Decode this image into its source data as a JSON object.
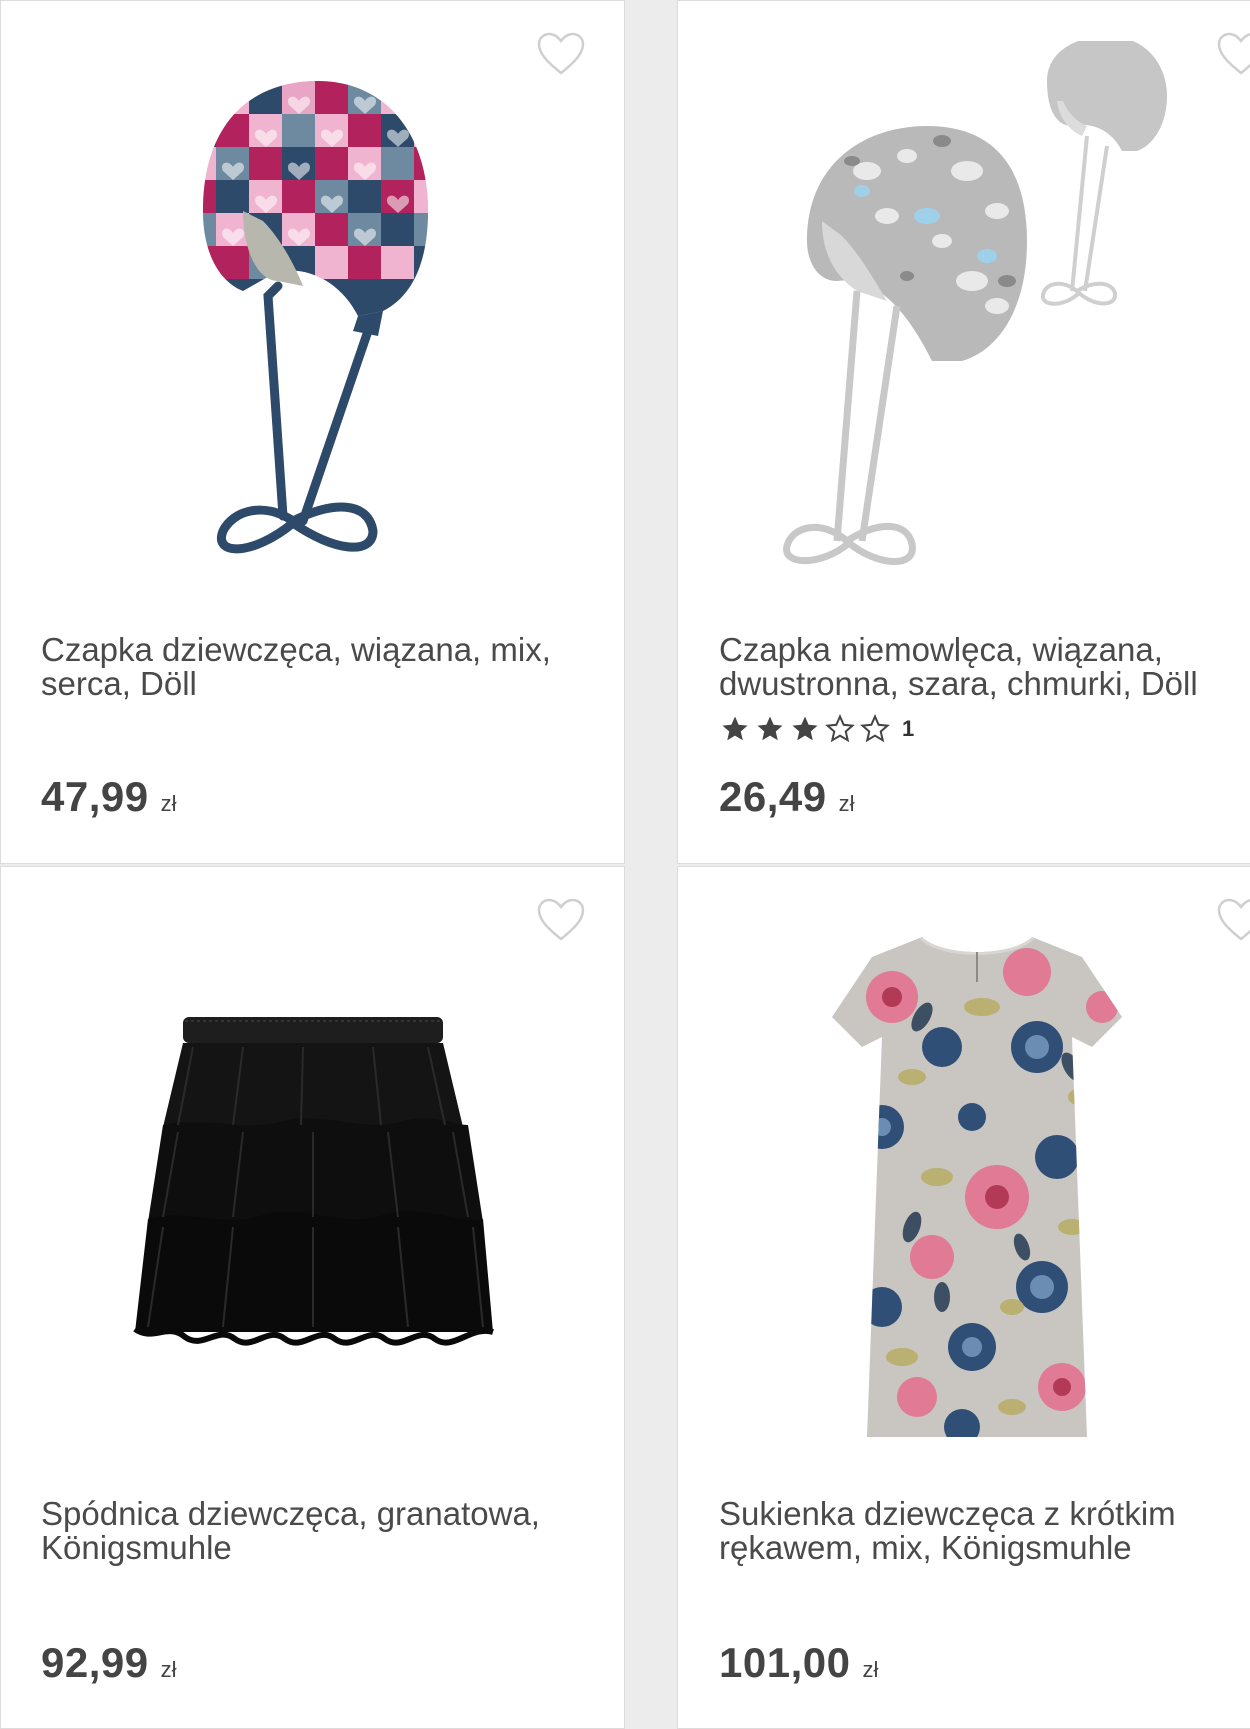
{
  "products": [
    {
      "title": "Czapka dziewczęca, wiązana, mix, serca, Döll",
      "price": "47,99",
      "currency": "zł",
      "image": "knitted-heart-hat-image"
    },
    {
      "title": "Czapka niemowlęca, wiązana, dwustronna, szara, chmurki, Döll",
      "price": "26,49",
      "currency": "zł",
      "rating": 3,
      "rating_max": 5,
      "rating_count": "1",
      "image": "grey-cloud-hat-image"
    },
    {
      "title": "Spódnica dziewczęca, granatowa, Königsmuhle",
      "price": "92,99",
      "currency": "zł",
      "image": "black-tulle-skirt-image"
    },
    {
      "title": "Sukienka dziewczęca z krótkim rękawem, mix, Königsmuhle",
      "price": "101,00",
      "currency": "zł",
      "image": "floral-dress-image"
    }
  ],
  "colors": {
    "background": "#ececec",
    "card": "#ffffff",
    "text": "#4a4a4a",
    "heart_outline": "#cfcfcf",
    "star": "#444444"
  },
  "icons": {
    "wishlist": "heart-outline-icon",
    "star_filled": "star-filled-icon",
    "star_empty": "star-outline-icon"
  }
}
